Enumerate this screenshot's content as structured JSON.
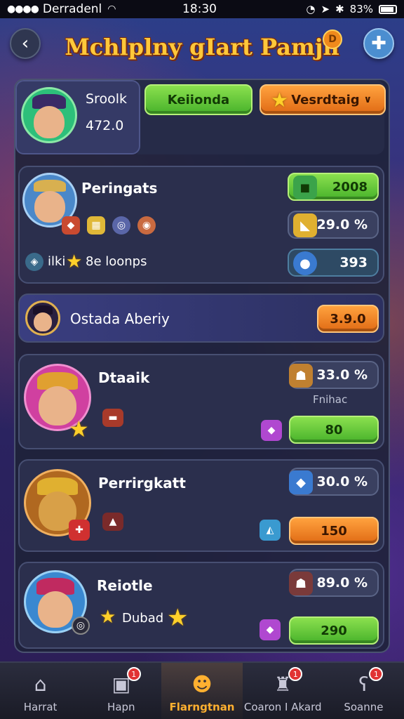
{
  "status_bar": {
    "carrier": "Derradenl",
    "time": "18:30",
    "battery": "83%"
  },
  "header": {
    "title": "Mchlplny gIart Pamjn",
    "coin_badge": "D"
  },
  "top_profile": {
    "name": "Sroolk",
    "score": "472.0",
    "button_primary": "Keiionda",
    "button_secondary": "Vesrdtaig"
  },
  "cards": [
    {
      "title": "Peringats",
      "stats": [
        "2008",
        "29.0 %",
        "393"
      ],
      "line_text": "ilki",
      "line_text_2": "8e loonps"
    },
    {
      "title": "Ostada Aberiy",
      "badge": "3.9.0"
    },
    {
      "title": "Dtaaik",
      "stats": [
        "33.0 %",
        "80"
      ],
      "sublabel": "Fnihac"
    },
    {
      "title": "Perrirgkatt",
      "stats": [
        "30.0 %",
        "150"
      ]
    },
    {
      "title": "Reiotle",
      "stats": [
        "89.0 %",
        "290"
      ],
      "line_text": "Dubad"
    }
  ],
  "bottom_nav": [
    {
      "label": "Harrat",
      "icon": "home-icon"
    },
    {
      "label": "Hapn",
      "icon": "map-icon",
      "badge": "1"
    },
    {
      "label": "Flarngtnan",
      "icon": "hero-icon",
      "active": true
    },
    {
      "label": "Coaron I Akard",
      "icon": "robot-icon",
      "badge": "1"
    },
    {
      "label": "Soanne",
      "icon": "bear-icon",
      "badge": "1"
    }
  ],
  "colors": {
    "accent_green": "#47b22b",
    "accent_orange": "#e06a14",
    "title_gold": "#ffc83a"
  }
}
